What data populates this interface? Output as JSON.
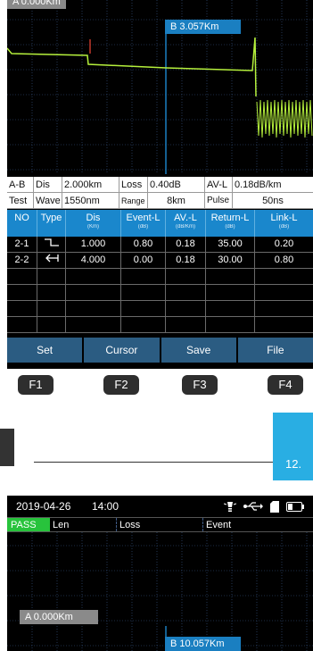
{
  "screen1": {
    "marker_a": "A 0.000Km",
    "marker_b": "B 3.057Km",
    "summary": {
      "row1": [
        "A-B",
        "Dis",
        "2.000km",
        "Loss",
        "0.40dB",
        "AV-L",
        "0.18dB/km"
      ],
      "row2": [
        "Test",
        "Wave",
        "1550nm",
        "Range",
        "8km",
        "Pulse",
        "50ns"
      ]
    },
    "table": {
      "headers": [
        {
          "label": "NO",
          "unit": ""
        },
        {
          "label": "Type",
          "unit": ""
        },
        {
          "label": "Dis",
          "unit": "(Km)"
        },
        {
          "label": "Event-L",
          "unit": "(dB)"
        },
        {
          "label": "AV.-L",
          "unit": "(dB/Km)"
        },
        {
          "label": "Return-L",
          "unit": "(dB)"
        },
        {
          "label": "Link-L",
          "unit": "(dB)"
        }
      ],
      "rows": [
        {
          "no": "2-1",
          "type": "step",
          "dis": "1.000",
          "event_l": "0.80",
          "av_l": "0.18",
          "return_l": "35.00",
          "link_l": "0.20"
        },
        {
          "no": "2-2",
          "type": "end",
          "dis": "4.000",
          "event_l": "0.00",
          "av_l": "0.18",
          "return_l": "30.00",
          "link_l": "0.80"
        }
      ]
    },
    "fkeys": [
      "Set",
      "Cursor",
      "Save",
      "File"
    ]
  },
  "hw_buttons": [
    "F1",
    "F2",
    "F3",
    "F4"
  ],
  "page_number": "12.",
  "screen2": {
    "date": "2019-04-26",
    "time": "14:00",
    "status_icons": [
      "lamp-icon",
      "usb-icon",
      "sd-card-icon",
      "battery-icon"
    ],
    "result": "PASS",
    "result_color": "#28c33c",
    "columns": [
      "Len",
      "Loss",
      "Event"
    ],
    "marker_a": "A 0.000Km",
    "marker_b": "B 10.057Km"
  },
  "colors": {
    "accent": "#1a87cc",
    "trace": "#b5f03c",
    "marker_a": "#c0392b",
    "marker_b": "#1a7fc1"
  }
}
